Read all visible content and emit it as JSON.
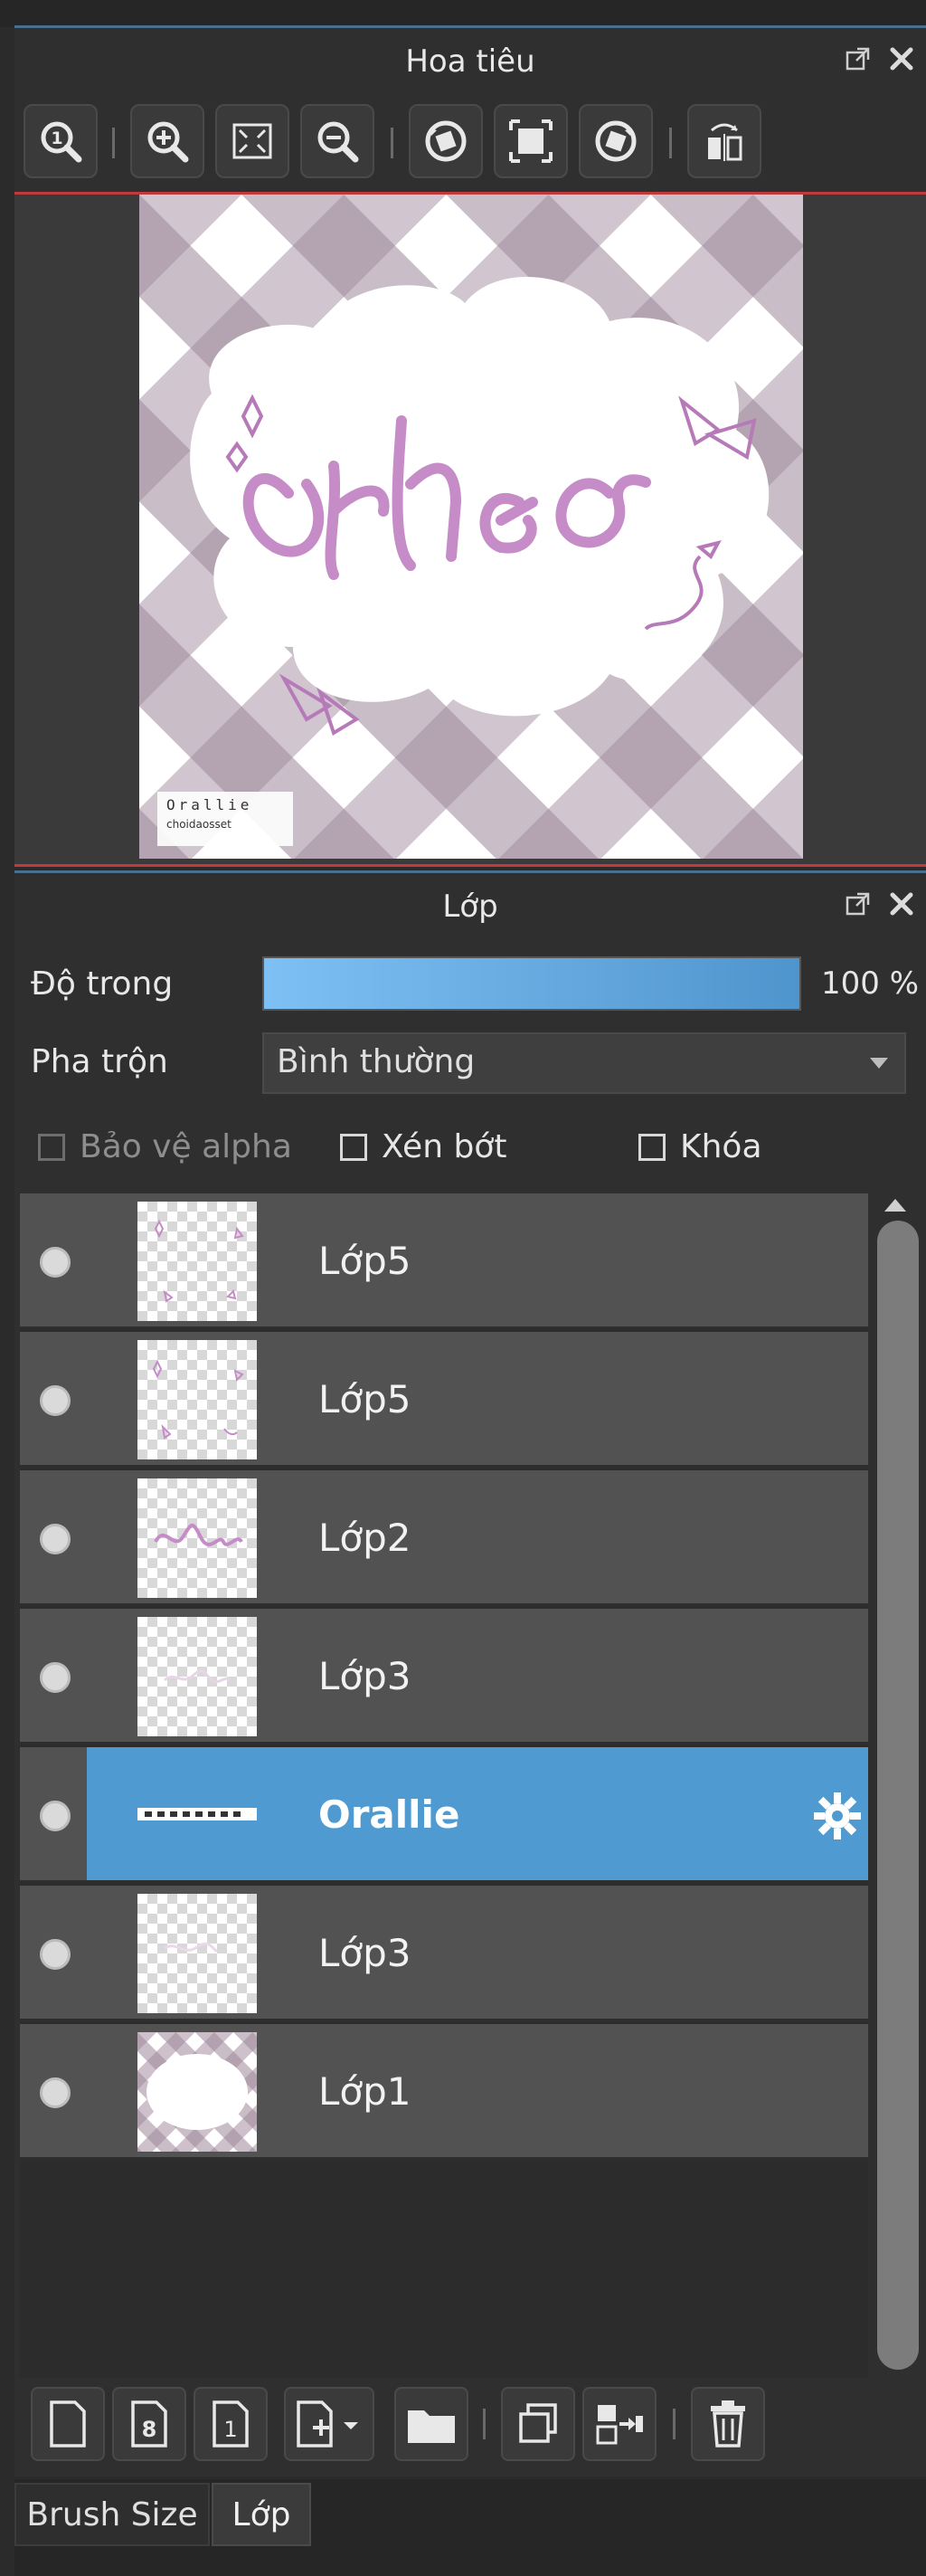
{
  "navigator": {
    "title": "Hoa tiêu",
    "toolbar": [
      {
        "icon": "zoom-actual-size-icon"
      },
      {
        "icon": "zoom-in-icon"
      },
      {
        "icon": "fit-to-window-icon"
      },
      {
        "icon": "zoom-out-icon"
      },
      {
        "icon": "rotate-left-icon"
      },
      {
        "icon": "reset-view-icon"
      },
      {
        "icon": "rotate-right-icon"
      },
      {
        "icon": "flip-horizontal-icon"
      }
    ],
    "preview": {
      "title_text": "Orheo",
      "watermark_line1": "Orallie",
      "watermark_line2": "choidaosset"
    }
  },
  "layers": {
    "title": "Lớp",
    "opacity_label": "Độ trong",
    "opacity_value": "100 %",
    "opacity_fraction": 1.0,
    "blend_label": "Pha trộn",
    "blend_value": "Bình thường",
    "protect_alpha_label": "Bảo vệ alpha",
    "clipping_label": "Xén bớt",
    "lock_label": "Khóa",
    "items": [
      {
        "name": "Lớp5",
        "selected": false,
        "thumb": "sparkles"
      },
      {
        "name": "Lớp5",
        "selected": false,
        "thumb": "sparkles"
      },
      {
        "name": "Lớp2",
        "selected": false,
        "thumb": "text"
      },
      {
        "name": "Lớp3",
        "selected": false,
        "thumb": "sketch"
      },
      {
        "name": "Orallie",
        "selected": true,
        "thumb": "strip"
      },
      {
        "name": "Lớp3",
        "selected": false,
        "thumb": "sketch"
      },
      {
        "name": "Lớp1",
        "selected": false,
        "thumb": "plaid"
      }
    ],
    "bottom_toolbar": [
      {
        "icon": "new-layer-icon"
      },
      {
        "icon": "new-8bit-layer-icon"
      },
      {
        "icon": "new-1bit-layer-icon"
      },
      {
        "icon": "add-layer-dropdown-icon"
      },
      {
        "icon": "new-folder-icon"
      },
      {
        "icon": "duplicate-layer-icon"
      },
      {
        "icon": "merge-down-icon"
      },
      {
        "icon": "delete-layer-icon"
      }
    ]
  },
  "tabs": {
    "brush_size": "Brush Size",
    "layer": "Lớp"
  },
  "colors": {
    "accent": "#4f9bd1",
    "plaid": "#a58da0",
    "ink": "#c58cc8"
  }
}
